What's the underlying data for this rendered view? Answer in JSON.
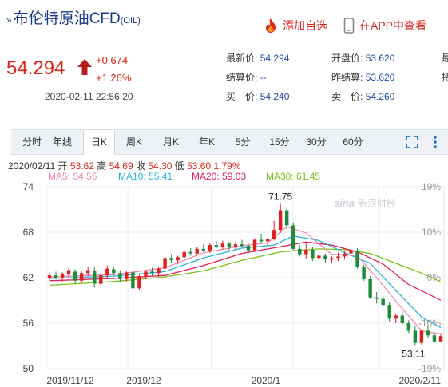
{
  "header": {
    "title": "布伦特原油CFD",
    "symbol": "(OIL)",
    "add_watch": "添加自选",
    "view_app": "在APP中查看"
  },
  "quote": {
    "price": "54.294",
    "change": "+0.674",
    "change_pct": "+1.26%",
    "timestamp": "2020-02-11 22:56:20",
    "latest_label": "最新价:",
    "latest_value": "54.294",
    "settle_label": "结算价:",
    "settle_value": "--",
    "bid_label": "买　价:",
    "bid_value": "54.240",
    "open_label": "开盘价:",
    "open_value": "53.620",
    "prev_settle_label": "昨结算:",
    "prev_settle_value": "53.620",
    "ask_label": "卖　价:",
    "ask_value": "54.260",
    "cut_col1": "最",
    "cut_col2": "持"
  },
  "tabs": [
    "分时",
    "年线",
    "日K",
    "周K",
    "月K",
    "年K",
    "5分",
    "15分",
    "30分",
    "60分"
  ],
  "active_tab": "日K",
  "info_line": {
    "date": "2020/02/11",
    "open_label": "开",
    "open": "53.62",
    "high_label": "高",
    "high": "54.69",
    "close_label": "收",
    "close": "54.30",
    "low_label": "低",
    "low": "53.60",
    "pct": "1.79%"
  },
  "ma_legend": {
    "ma5": "MA5: 54.55",
    "ma10": "MA10: 55.41",
    "ma20": "MA20: 59.03",
    "ma30": "MA30: 61.45"
  },
  "watermark": "新浪财经",
  "colors": {
    "up": "#e02020",
    "down": "#1f8a3b",
    "ma5": "#f08ab0",
    "ma10": "#2ab4d8",
    "ma20": "#e01e5a",
    "ma30": "#7cc21a",
    "accent": "#d7261b",
    "blue": "#1e4aa8"
  },
  "chart_data": {
    "type": "candlestick",
    "ylim": [
      50,
      74
    ],
    "y_ticks": [
      "74",
      "68",
      "62",
      "56",
      "50"
    ],
    "right_ticks": [
      "19%",
      "10%",
      "0%",
      "-10%",
      "-19%"
    ],
    "x_labels": [
      "2019/11/12",
      "2019/12",
      "2020/1",
      "2020/2/11"
    ],
    "annotations": {
      "max": "71.75",
      "min": "53.11"
    },
    "candles": [
      [
        62.0,
        62.6,
        61.6,
        62.3
      ],
      [
        62.3,
        62.8,
        61.8,
        62.0
      ],
      [
        61.9,
        62.7,
        61.5,
        62.5
      ],
      [
        62.4,
        63.3,
        62.0,
        63.0
      ],
      [
        62.8,
        63.1,
        61.2,
        61.6
      ],
      [
        61.6,
        62.9,
        61.3,
        62.6
      ],
      [
        62.6,
        63.4,
        62.2,
        63.0
      ],
      [
        62.9,
        63.5,
        60.7,
        61.2
      ],
      [
        61.2,
        62.6,
        60.8,
        62.3
      ],
      [
        62.3,
        63.6,
        62.0,
        63.2
      ],
      [
        63.1,
        63.4,
        62.3,
        62.6
      ],
      [
        62.6,
        63.0,
        61.4,
        61.8
      ],
      [
        61.8,
        62.9,
        61.5,
        62.7
      ],
      [
        62.7,
        63.1,
        60.2,
        60.6
      ],
      [
        60.6,
        62.4,
        60.4,
        62.2
      ],
      [
        62.2,
        63.0,
        61.8,
        62.8
      ],
      [
        62.8,
        63.3,
        62.2,
        62.6
      ],
      [
        62.6,
        63.4,
        62.1,
        63.2
      ],
      [
        63.2,
        64.8,
        63.0,
        64.6
      ],
      [
        64.6,
        65.1,
        64.0,
        64.3
      ],
      [
        64.3,
        64.9,
        63.8,
        64.7
      ],
      [
        64.7,
        65.6,
        64.4,
        65.4
      ],
      [
        65.4,
        65.9,
        64.9,
        65.2
      ],
      [
        65.2,
        66.0,
        64.9,
        65.8
      ],
      [
        65.8,
        66.4,
        65.4,
        65.6
      ],
      [
        65.6,
        66.6,
        65.3,
        66.3
      ],
      [
        66.3,
        66.8,
        65.9,
        66.1
      ],
      [
        66.1,
        66.9,
        65.8,
        66.5
      ],
      [
        66.5,
        66.7,
        65.6,
        66.0
      ],
      [
        66.0,
        66.8,
        65.7,
        66.4
      ],
      [
        66.4,
        67.0,
        66.0,
        66.2
      ],
      [
        66.2,
        66.5,
        65.2,
        65.6
      ],
      [
        65.6,
        67.2,
        65.4,
        67.0
      ],
      [
        67.0,
        67.8,
        66.6,
        66.8
      ],
      [
        66.8,
        67.2,
        66.2,
        67.1
      ],
      [
        67.1,
        69.5,
        66.9,
        68.3
      ],
      [
        68.3,
        71.75,
        67.9,
        70.9
      ],
      [
        70.9,
        71.2,
        68.3,
        68.9
      ],
      [
        68.9,
        69.3,
        65.6,
        65.8
      ],
      [
        65.8,
        66.3,
        64.8,
        65.1
      ],
      [
        65.1,
        66.5,
        64.5,
        65.7
      ],
      [
        65.7,
        66.0,
        64.2,
        64.6
      ],
      [
        64.6,
        65.4,
        64.0,
        64.9
      ],
      [
        64.9,
        65.2,
        63.9,
        64.4
      ],
      [
        64.4,
        64.8,
        64.0,
        64.6
      ],
      [
        64.6,
        65.3,
        64.2,
        64.8
      ],
      [
        64.8,
        65.5,
        64.4,
        65.2
      ],
      [
        65.2,
        65.8,
        64.8,
        65.6
      ],
      [
        65.6,
        65.9,
        63.2,
        63.4
      ],
      [
        63.4,
        63.7,
        61.6,
        61.8
      ],
      [
        61.8,
        62.2,
        59.2,
        59.4
      ],
      [
        59.4,
        60.1,
        58.6,
        59.2
      ],
      [
        59.2,
        59.6,
        58.1,
        58.4
      ],
      [
        58.4,
        58.8,
        56.2,
        56.6
      ],
      [
        56.6,
        57.3,
        56.0,
        57.0
      ],
      [
        57.0,
        57.6,
        55.8,
        56.0
      ],
      [
        56.0,
        56.4,
        54.7,
        55.0
      ],
      [
        55.0,
        55.6,
        53.11,
        53.4
      ],
      [
        53.4,
        55.2,
        53.2,
        55.0
      ],
      [
        55.0,
        55.7,
        54.1,
        54.4
      ],
      [
        54.4,
        54.8,
        53.4,
        53.6
      ],
      [
        53.6,
        54.69,
        53.6,
        54.3
      ]
    ],
    "ma5": [
      [
        0,
        62.1
      ],
      [
        10,
        62.4
      ],
      [
        18,
        63.3
      ],
      [
        24,
        65.3
      ],
      [
        30,
        66.2
      ],
      [
        34,
        66.6
      ],
      [
        37,
        68.7
      ],
      [
        40,
        67.9
      ],
      [
        44,
        65.1
      ],
      [
        48,
        64.9
      ],
      [
        51,
        62.0
      ],
      [
        54,
        58.9
      ],
      [
        58,
        55.0
      ],
      [
        61,
        54.55
      ]
    ],
    "ma10": [
      [
        0,
        61.9
      ],
      [
        10,
        62.2
      ],
      [
        18,
        62.8
      ],
      [
        24,
        64.6
      ],
      [
        30,
        65.9
      ],
      [
        35,
        66.3
      ],
      [
        38,
        67.5
      ],
      [
        42,
        66.9
      ],
      [
        46,
        65.3
      ],
      [
        50,
        63.9
      ],
      [
        54,
        60.3
      ],
      [
        58,
        56.8
      ],
      [
        61,
        55.41
      ]
    ],
    "ma20": [
      [
        0,
        61.6
      ],
      [
        10,
        61.9
      ],
      [
        18,
        62.3
      ],
      [
        24,
        63.6
      ],
      [
        30,
        65.2
      ],
      [
        36,
        66.1
      ],
      [
        40,
        66.7
      ],
      [
        44,
        66.3
      ],
      [
        48,
        65.4
      ],
      [
        52,
        63.8
      ],
      [
        56,
        61.1
      ],
      [
        61,
        59.03
      ]
    ],
    "ma30": [
      [
        0,
        61.0
      ],
      [
        10,
        61.5
      ],
      [
        18,
        62.1
      ],
      [
        24,
        62.9
      ],
      [
        30,
        64.3
      ],
      [
        36,
        65.4
      ],
      [
        42,
        65.8
      ],
      [
        46,
        65.7
      ],
      [
        50,
        65.2
      ],
      [
        54,
        63.9
      ],
      [
        58,
        62.6
      ],
      [
        61,
        61.45
      ]
    ]
  }
}
